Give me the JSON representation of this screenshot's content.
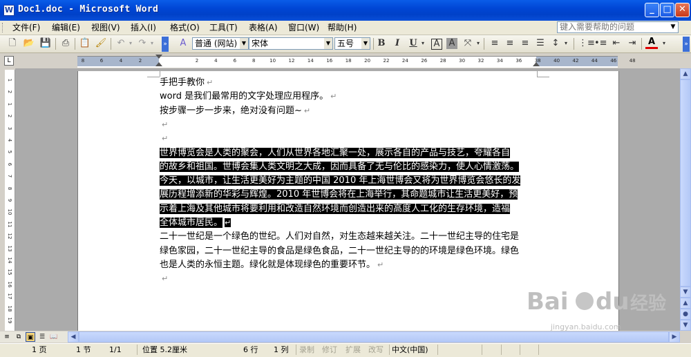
{
  "window": {
    "title": "Doc1.doc - Microsoft Word",
    "app_icon": "W",
    "minimize": "_",
    "maximize": "□",
    "close": "✕"
  },
  "menu": {
    "items": [
      "文件(F)",
      "编辑(E)",
      "视图(V)",
      "插入(I)",
      "格式(O)",
      "工具(T)",
      "表格(A)",
      "窗口(W)",
      "帮助(H)"
    ],
    "help_placeholder": "键入需要帮助的问题"
  },
  "toolbar": {
    "style_value": "普通 (网站)",
    "font_value": "宋体",
    "size_value": "五号",
    "bold": "B",
    "italic": "I",
    "underline": "U",
    "icons": [
      "new-document-icon",
      "open-folder-icon",
      "save-icon",
      "print-icon",
      "paste-icon",
      "format-painter-icon",
      "undo-icon",
      "redo-icon",
      "styles-icon",
      "bold-icon",
      "italic-icon",
      "underline-icon",
      "char-border-icon",
      "char-shading-icon",
      "scale-icon",
      "align-left-icon",
      "center-icon",
      "align-right-icon",
      "justify-icon",
      "line-spacing-icon",
      "numbering-icon",
      "bullets-icon",
      "decrease-indent-icon",
      "increase-indent-icon",
      "font-color-icon"
    ]
  },
  "ruler": {
    "left_ticks": [
      "8",
      "6",
      "4",
      "2"
    ],
    "marks": [
      "2",
      "4",
      "6",
      "8",
      "10",
      "12",
      "14",
      "16",
      "18",
      "20",
      "22",
      "24",
      "26",
      "28",
      "30",
      "32",
      "34",
      "36",
      "38",
      "40",
      "42",
      "44",
      "46",
      "48"
    ],
    "vertical_marks": [
      "1",
      "2",
      "1",
      "2",
      "3",
      "4",
      "5",
      "6",
      "7",
      "8",
      "9",
      "10",
      "11",
      "12",
      "13",
      "14",
      "15",
      "16",
      "17",
      "18",
      "19"
    ]
  },
  "document": {
    "lines": [
      {
        "text": "手把手教你",
        "selected": false
      },
      {
        "text": "word 是我们最常用的文字处理应用程序。",
        "selected": false
      },
      {
        "text": "按步骤一步一步来，绝对没有问题~",
        "selected": false
      },
      {
        "text": "",
        "selected": false
      },
      {
        "text": "",
        "selected": false
      },
      {
        "text": "世界博览会是人类的聚会，人们从世界各地汇聚一处，展示各自的产品与技艺，夸耀各自",
        "selected": true
      },
      {
        "text": "的故乡和祖国。世博会集人类文明之大成，因而具备了无与伦比的感染力，使人心情激荡。",
        "selected": true
      },
      {
        "text": "今天，以城市，让生活更美好为主题的中国 2010 年上海世博会又将为世界博览会悠长的发",
        "selected": true
      },
      {
        "text": "展历程增添新的华彩与辉煌。2010 年世博会将在上海举行，其命题城市让生活更美好，预",
        "selected": true
      },
      {
        "text": "示着上海及其他城市将要利用和改造自然环境而创造出来的高度人工化的生存环境，造福",
        "selected": true
      },
      {
        "text": "全体城市居民。",
        "selected": true
      },
      {
        "text": "二十一世纪是一个绿色的世纪。人们对自然，对生态越来越关注。二十一世纪主导的住宅是",
        "selected": false
      },
      {
        "text": "绿色家园，二十一世纪主导的食品是绿色食品，二十一世纪主导的的环境是绿色环境。绿色",
        "selected": false
      },
      {
        "text": "也是人类的永恒主题。绿化就是体现绿色的重要环节。",
        "selected": false
      },
      {
        "text": "",
        "selected": false
      }
    ],
    "paragraph_mark": "↵"
  },
  "status": {
    "page": "1 页",
    "section": "1 节",
    "page_of": "1/1",
    "position": "位置 5.2厘米",
    "line": "6 行",
    "column": "1 列",
    "rec": "录制",
    "trk": "修订",
    "ext": "扩展",
    "ovr": "改写",
    "language": "中文(中国)"
  },
  "watermark": {
    "logo": "Bai du 经验",
    "url": "jingyan.baidu.com"
  }
}
